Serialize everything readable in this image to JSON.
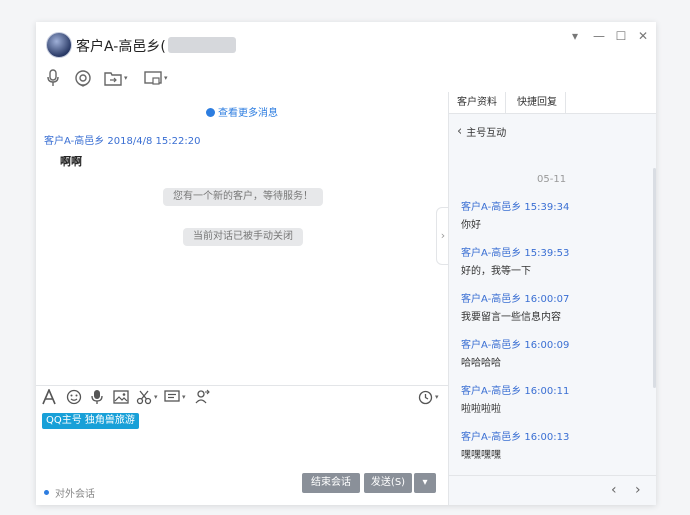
{
  "window": {
    "title": "客户A-高邑乡(",
    "controls": {
      "dropdown": "▾",
      "minimize": "—",
      "maximize": "☐",
      "close": "✕"
    }
  },
  "toolbar": {
    "icons": [
      "microphone-icon",
      "headset-icon",
      "folder-transfer-icon",
      "screenshot-icon"
    ]
  },
  "chat": {
    "more_history": "查看更多消息",
    "message": {
      "sender": "客户A-高邑乡",
      "timestamp": "2018/4/8 15:22:20",
      "text": "啊啊"
    },
    "system_notices": [
      "您有一个新的客户，等待服务！",
      "当前对话已被手动关闭"
    ]
  },
  "input": {
    "tag": "QQ主号 独角兽旅游",
    "status": "对外会话",
    "end_button": "结束会话",
    "send_button": "发送(S)"
  },
  "side": {
    "tabs": [
      "客户资料",
      "快捷回复"
    ],
    "back_label": "主号互动",
    "date": "05-11",
    "messages": [
      {
        "meta": "客户A-高邑乡 15:39:34",
        "text": "你好"
      },
      {
        "meta": "客户A-高邑乡 15:39:53",
        "text": "好的，我等一下"
      },
      {
        "meta": "客户A-高邑乡 16:00:07",
        "text": "我要留言一些信息内容"
      },
      {
        "meta": "客户A-高邑乡 16:00:09",
        "text": "哈哈哈哈"
      },
      {
        "meta": "客户A-高邑乡 16:00:11",
        "text": "啦啦啦啦"
      },
      {
        "meta": "客户A-高邑乡 16:00:13",
        "text": "嘿嘿嘿嘿"
      }
    ]
  },
  "colors": {
    "accent": "#2d7de0",
    "tag": "#18a0d8",
    "button": "#8a9099"
  }
}
